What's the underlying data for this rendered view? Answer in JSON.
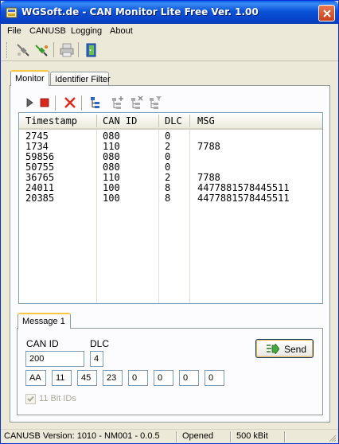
{
  "window": {
    "title": "WGSoft.de - CAN Monitor Lite Free Ver. 1.00"
  },
  "menu": {
    "items": [
      {
        "label": "File"
      },
      {
        "label": "CANUSB"
      },
      {
        "label": "Logging"
      },
      {
        "label": "About"
      }
    ]
  },
  "toolbar": {
    "icons": [
      "disconnect-icon",
      "connect-icon",
      "print-icon",
      "exit-icon"
    ]
  },
  "tabs": [
    {
      "label": "Monitor",
      "active": true
    },
    {
      "label": "Identifier Filter",
      "active": false
    }
  ],
  "monitor_toolbar": {
    "icons": [
      "play-icon",
      "stop-icon",
      "clear-icon",
      "tree-icon",
      "tree-add-icon",
      "tree-remove-icon",
      "tree-filter-icon"
    ]
  },
  "messages": {
    "columns": [
      "Timestamp",
      "CAN ID",
      "DLC",
      "MSG"
    ],
    "rows": [
      {
        "timestamp": "2745",
        "can_id": "080",
        "dlc": "0",
        "msg": ""
      },
      {
        "timestamp": "1734",
        "can_id": "110",
        "dlc": "2",
        "msg": "7788"
      },
      {
        "timestamp": "59856",
        "can_id": "080",
        "dlc": "0",
        "msg": ""
      },
      {
        "timestamp": "50755",
        "can_id": "080",
        "dlc": "0",
        "msg": ""
      },
      {
        "timestamp": "36765",
        "can_id": "110",
        "dlc": "2",
        "msg": "7788"
      },
      {
        "timestamp": "24011",
        "can_id": "100",
        "dlc": "8",
        "msg": "4477881578445511"
      },
      {
        "timestamp": "20385",
        "can_id": "100",
        "dlc": "8",
        "msg": "4477881578445511"
      }
    ]
  },
  "message_panel": {
    "tab_label": "Message 1",
    "can_id_label": "CAN ID",
    "can_id_value": "200",
    "dlc_label": "DLC",
    "dlc_value": "4",
    "data_bytes": [
      "AA",
      "11",
      "45",
      "23",
      "0",
      "0",
      "0",
      "0"
    ],
    "send_label": "Send",
    "checkbox_label": "11 Bit IDs",
    "checkbox_checked": true,
    "checkbox_enabled": false
  },
  "status": {
    "version": "CANUSB Version: 1010 - NM001 - 0.0.5",
    "state": "Opened",
    "bitrate": "500 kBit"
  },
  "colors": {
    "titlebar": "#0b54d9",
    "window_bg": "#ece9d8",
    "tab_highlight": "#ffc83c",
    "stop": "#d8281c",
    "clear": "#e02a1c"
  }
}
